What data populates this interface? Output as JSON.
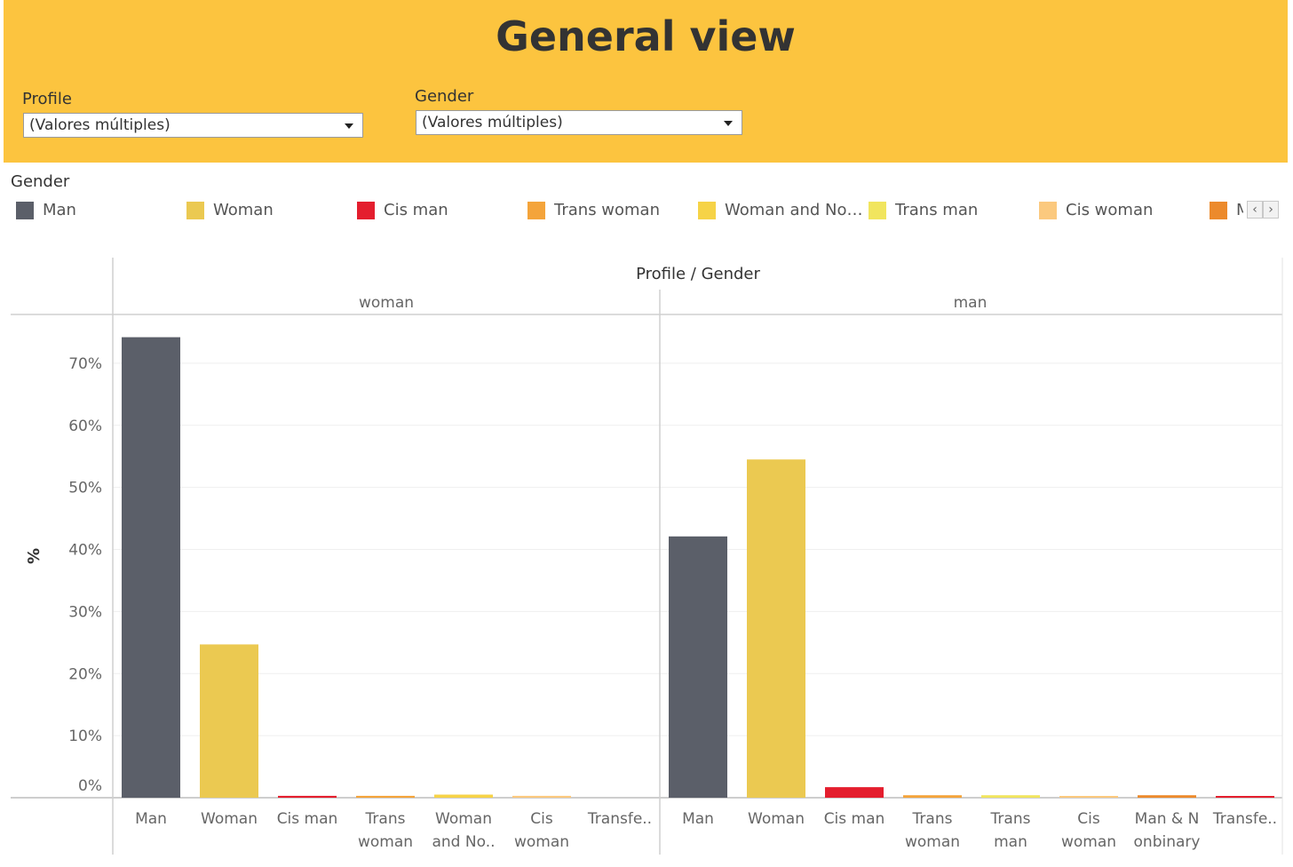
{
  "header": {
    "title": "General view"
  },
  "filters": [
    {
      "label": "Profile",
      "value": "(Valores múltiples)"
    },
    {
      "label": "Gender",
      "value": "(Valores múltiples)"
    }
  ],
  "legend": {
    "title": "Gender",
    "items": [
      {
        "label": "Man",
        "color": "#5b5f69"
      },
      {
        "label": "Woman",
        "color": "#ebc951"
      },
      {
        "label": "Cis man",
        "color": "#e41e2e"
      },
      {
        "label": "Trans woman",
        "color": "#f4a43b"
      },
      {
        "label": "Woman and No…",
        "color": "#f6d347"
      },
      {
        "label": "Trans man",
        "color": "#f1e55e"
      },
      {
        "label": "Cis woman",
        "color": "#fbc97e"
      },
      {
        "label": "Man & Nonbinary",
        "color": "#ec8a2c"
      }
    ],
    "prev_icon": "chevron-left-icon",
    "next_icon": "chevron-right-icon"
  },
  "chart_data": {
    "type": "bar",
    "header": "Profile / Gender",
    "ylabel": "%",
    "ylim": [
      0,
      75
    ],
    "yticks": [
      "70%",
      "60%",
      "50%",
      "40%",
      "30%",
      "20%",
      "10%",
      "0%"
    ],
    "grid": true,
    "panels": [
      {
        "name": "woman",
        "bars": [
          {
            "label": [
              "Man"
            ],
            "value": 74.2,
            "color": "#5b5f69"
          },
          {
            "label": [
              "Woman"
            ],
            "value": 24.7,
            "color": "#ebc951"
          },
          {
            "label": [
              "Cis man"
            ],
            "value": 0.3,
            "color": "#e41e2e"
          },
          {
            "label": [
              "Trans",
              "woman"
            ],
            "value": 0.3,
            "color": "#f4a43b"
          },
          {
            "label": [
              "Woman",
              "and No.."
            ],
            "value": 0.5,
            "color": "#f6d347"
          },
          {
            "label": [
              "Cis",
              "woman"
            ],
            "value": 0.3,
            "color": "#fbc97e"
          },
          {
            "label": [
              "Transfe.."
            ],
            "value": 0.0,
            "color": "#e41e2e"
          }
        ]
      },
      {
        "name": "man",
        "bars": [
          {
            "label": [
              "Man"
            ],
            "value": 42.1,
            "color": "#5b5f69"
          },
          {
            "label": [
              "Woman"
            ],
            "value": 54.5,
            "color": "#ebc951"
          },
          {
            "label": [
              "Cis man"
            ],
            "value": 1.7,
            "color": "#e41e2e"
          },
          {
            "label": [
              "Trans",
              "woman"
            ],
            "value": 0.4,
            "color": "#f4a43b"
          },
          {
            "label": [
              "Trans",
              "man"
            ],
            "value": 0.4,
            "color": "#f1e55e"
          },
          {
            "label": [
              "Cis",
              "woman"
            ],
            "value": 0.2,
            "color": "#fbc97e"
          },
          {
            "label": [
              "Man & N",
              "onbinary"
            ],
            "value": 0.4,
            "color": "#ec8a2c"
          },
          {
            "label": [
              "Transfe.."
            ],
            "value": 0.2,
            "color": "#e41e2e"
          }
        ]
      }
    ]
  }
}
